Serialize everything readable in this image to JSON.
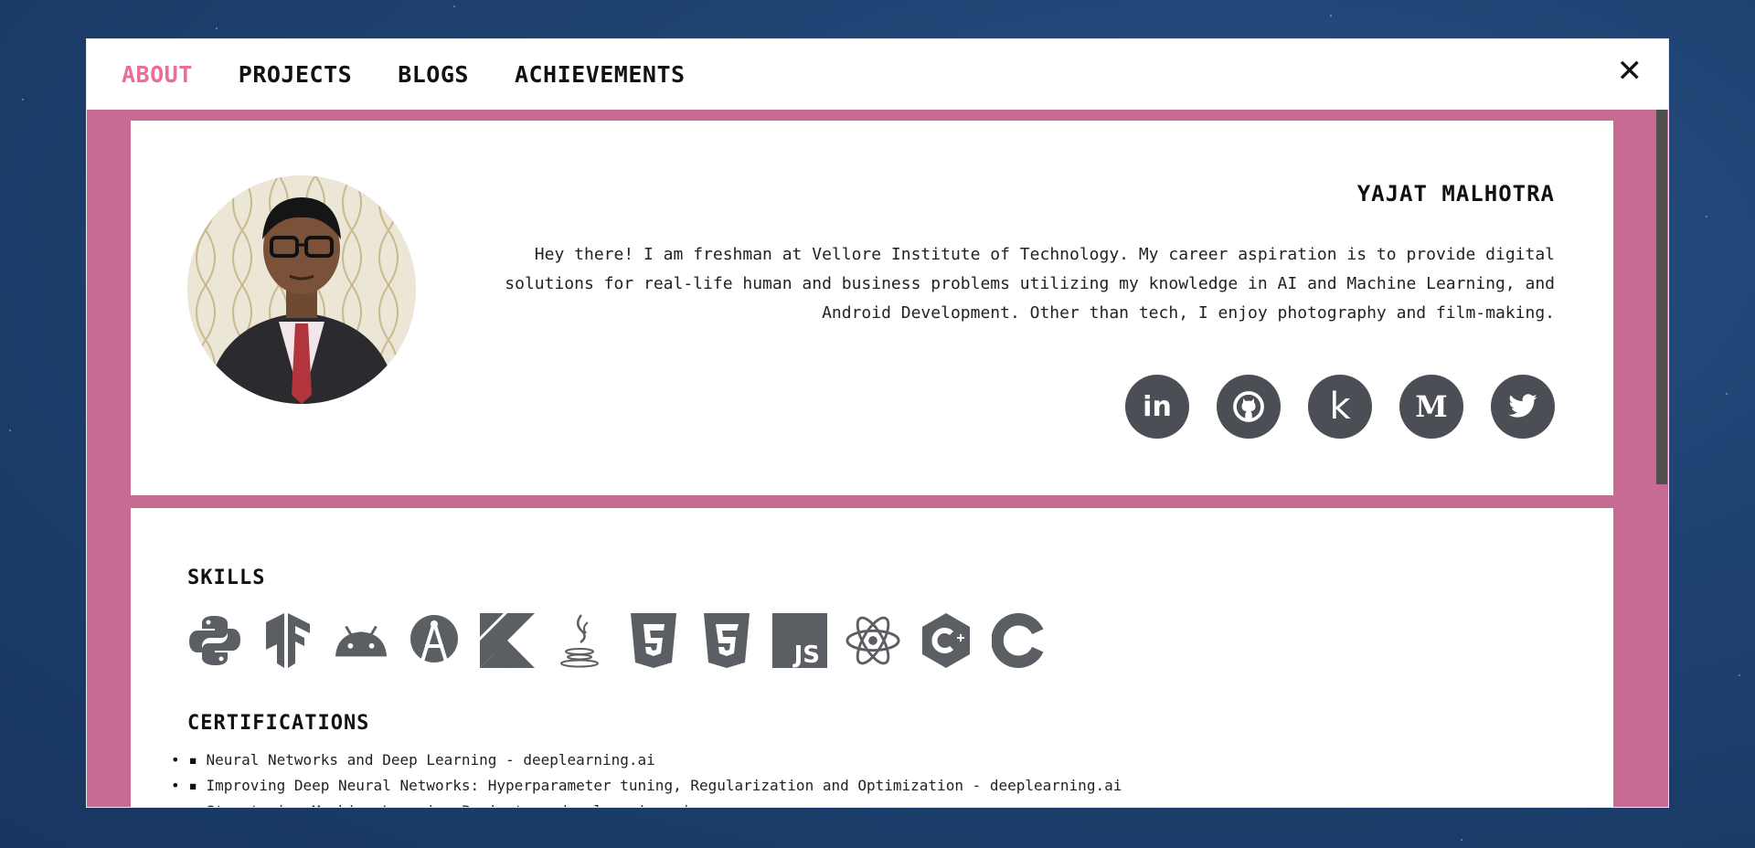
{
  "nav": {
    "items": [
      {
        "label": "ABOUT",
        "active": true
      },
      {
        "label": "PROJECTS",
        "active": false
      },
      {
        "label": "BLOGS",
        "active": false
      },
      {
        "label": "ACHIEVEMENTS",
        "active": false
      }
    ],
    "close_label": "✕"
  },
  "about": {
    "name": "YAJAT MALHOTRA",
    "bio": "Hey there! I am freshman at Vellore Institute of Technology. My career aspiration is to provide digital solutions for real-life human and business problems utilizing my knowledge in AI and Machine Learning, and Android Development. Other than tech, I enjoy photography and film-making.",
    "socials": [
      {
        "icon": "linkedin-icon",
        "glyph": "in"
      },
      {
        "icon": "github-icon",
        "glyph": ""
      },
      {
        "icon": "kaggle-icon",
        "glyph": "k"
      },
      {
        "icon": "medium-icon",
        "glyph": "M"
      },
      {
        "icon": "twitter-icon",
        "glyph": ""
      }
    ]
  },
  "skills": {
    "title": "SKILLS",
    "icons": [
      "python-icon",
      "tensorflow-icon",
      "android-icon",
      "android-studio-icon",
      "kotlin-icon",
      "java-icon",
      "html5-icon",
      "css3-icon",
      "javascript-icon",
      "react-icon",
      "cpp-icon",
      "c-icon"
    ]
  },
  "certifications": {
    "title": "CERTIFICATIONS",
    "items": [
      "Neural Networks and Deep Learning - deeplearning.ai",
      "Improving Deep Neural Networks: Hyperparameter tuning, Regularization and Optimization - deeplearning.ai",
      "Structuring Machine Learning Projects - deeplearning.ai"
    ]
  },
  "colors": {
    "accent": "#ea6f98",
    "frame": "#c86b92",
    "icon": "#4b4f55"
  }
}
